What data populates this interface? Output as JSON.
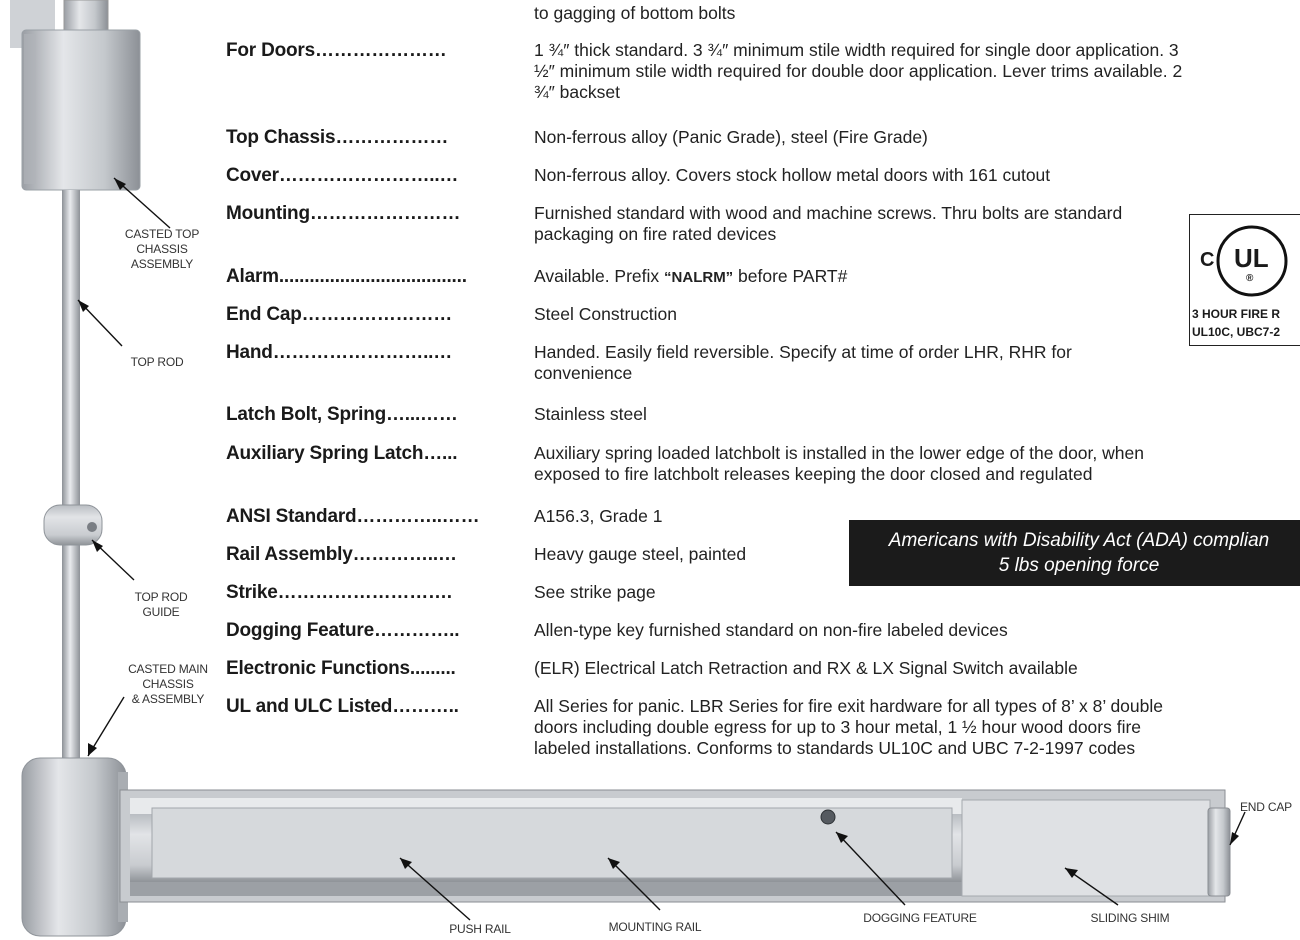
{
  "top_line": "to gagging of bottom bolts",
  "specs": [
    {
      "label": "For Doors…………………",
      "value": "1 ¾″ thick standard. 3 ¾″ minimum stile width required for single door application. 3 ½″ minimum stile width required for double door application. Lever trims available. 2 ¾″ backset"
    },
    {
      "label": "Top Chassis………………",
      "value": "Non-ferrous alloy (Panic Grade), steel (Fire Grade)"
    },
    {
      "label": "Cover……………………..…",
      "value": "Non-ferrous alloy. Covers stock hollow metal doors with 161 cutout"
    },
    {
      "label": "Mounting……………………",
      "value": "Furnished standard with wood and machine screws. Thru bolts are standard packaging on fire rated devices"
    },
    {
      "label": "Alarm.....................................",
      "value_pre": "Available. Prefix ",
      "value_strong": "“NALRM”",
      "value_post": " before PART#"
    },
    {
      "label": "End Cap……………………",
      "value": "Steel Construction"
    },
    {
      "label": "Hand……………………..…",
      "value": "Handed. Easily field reversible. Specify at time of order LHR, RHR for convenience"
    },
    {
      "label": "Latch Bolt, Spring…...……",
      "value": "Stainless steel"
    },
    {
      "label": "Auxiliary Spring Latch…...",
      "value": "Auxiliary spring loaded latchbolt is installed in the lower edge of the door, when exposed to fire latchbolt releases keeping the door closed and regulated"
    },
    {
      "label": "ANSI Standard…………..……",
      "value": "A156.3, Grade 1"
    },
    {
      "label": "Rail Assembly…………..…",
      "value": "Heavy gauge steel, painted"
    },
    {
      "label": "Strike……………………….",
      "value": "See strike page"
    },
    {
      "label": "Dogging Feature…………..",
      "value": "Allen-type key furnished standard on non-fire labeled devices"
    },
    {
      "label": "Electronic Functions.........",
      "value": "(ELR) Electrical Latch Retraction and RX & LX Signal Switch available"
    },
    {
      "label": "UL and ULC Listed………..",
      "value": "All Series for panic. LBR Series for fire exit hardware for all types of 8’ x 8’ double doors including double egress for up to 3 hour metal, 1 ½ hour wood doors fire labeled installations. Conforms to standards UL10C and UBC 7-2-1997 codes"
    }
  ],
  "ada_banner": {
    "line1": "Americans with Disability Act (ADA) complian",
    "line2": "5 lbs opening force"
  },
  "ul_logo": {
    "c": "C",
    "ul": "UL",
    "r": "®",
    "line1": "3 HOUR FIRE R",
    "line2": "UL10C, UBC7-2"
  },
  "callouts": {
    "casted_top_chassis": [
      "CASTED TOP",
      "CHASSIS",
      "ASSEMBLY"
    ],
    "top_rod": "TOP ROD",
    "top_rod_guide": [
      "TOP ROD",
      "GUIDE"
    ],
    "casted_main_chassis": [
      "CASTED MAIN",
      "CHASSIS",
      "& ASSEMBLY"
    ],
    "push_rail": "PUSH RAIL",
    "mounting_rail": "MOUNTING RAIL",
    "dogging_feature": "DOGGING FEATURE",
    "sliding_shim": "SLIDING SHIM",
    "end_cap": "END CAP"
  }
}
